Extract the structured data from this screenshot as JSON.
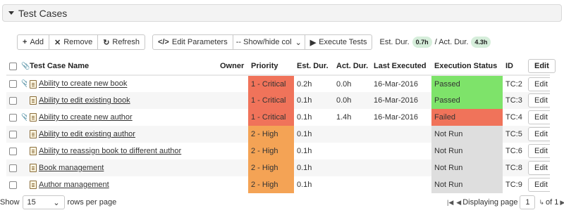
{
  "panel": {
    "title": "Test Cases"
  },
  "toolbar": {
    "add_label": "Add",
    "remove_label": "Remove",
    "refresh_label": "Refresh",
    "edit_params_label": "Edit Parameters",
    "show_hide_label": "-- Show/hide col",
    "execute_label": "Execute Tests",
    "est_dur_label": "Est. Dur.",
    "est_dur_value": "0.7h",
    "act_dur_label": "/ Act. Dur.",
    "act_dur_value": "4.3h"
  },
  "columns": {
    "name": "Test Case Name",
    "owner": "Owner",
    "priority": "Priority",
    "est_dur": "Est. Dur.",
    "act_dur": "Act. Dur.",
    "last_executed": "Last Executed",
    "status": "Execution Status",
    "id": "ID",
    "edit_header": "Edit"
  },
  "rows": [
    {
      "name": "Ability to create new book",
      "attachment": true,
      "owner": "",
      "priority": "1 - Critical",
      "priority_color": "#f0735a",
      "est_dur": "0.2h",
      "act_dur": "0.0h",
      "last_executed": "16-Mar-2016",
      "status": "Passed",
      "status_color": "#7ee36a",
      "id": "TC:2",
      "edit": "Edit"
    },
    {
      "name": "Ability to edit existing book",
      "attachment": false,
      "owner": "",
      "priority": "1 - Critical",
      "priority_color": "#f0735a",
      "est_dur": "0.1h",
      "act_dur": "0.0h",
      "last_executed": "16-Mar-2016",
      "status": "Passed",
      "status_color": "#7ee36a",
      "id": "TC:3",
      "edit": "Edit"
    },
    {
      "name": "Ability to create new author",
      "attachment": true,
      "owner": "",
      "priority": "1 - Critical",
      "priority_color": "#f0735a",
      "est_dur": "0.1h",
      "act_dur": "1.4h",
      "last_executed": "16-Mar-2016",
      "status": "Failed",
      "status_color": "#f0735a",
      "id": "TC:4",
      "edit": "Edit"
    },
    {
      "name": "Ability to edit existing author",
      "attachment": false,
      "owner": "",
      "priority": "2 - High",
      "priority_color": "#f4a355",
      "est_dur": "0.1h",
      "act_dur": "",
      "last_executed": "",
      "status": "Not Run",
      "status_color": "#dedede",
      "id": "TC:5",
      "edit": "Edit"
    },
    {
      "name": "Ability to reassign book to different author",
      "attachment": false,
      "owner": "",
      "priority": "2 - High",
      "priority_color": "#f4a355",
      "est_dur": "0.1h",
      "act_dur": "",
      "last_executed": "",
      "status": "Not Run",
      "status_color": "#dedede",
      "id": "TC:6",
      "edit": "Edit"
    },
    {
      "name": "Book management",
      "attachment": false,
      "owner": "",
      "priority": "2 - High",
      "priority_color": "#f4a355",
      "est_dur": "0.1h",
      "act_dur": "",
      "last_executed": "",
      "status": "Not Run",
      "status_color": "#dedede",
      "id": "TC:8",
      "edit": "Edit"
    },
    {
      "name": "Author management",
      "attachment": false,
      "owner": "",
      "priority": "2 - High",
      "priority_color": "#f4a355",
      "est_dur": "0.1h",
      "act_dur": "",
      "last_executed": "",
      "status": "Not Run",
      "status_color": "#dedede",
      "id": "TC:9",
      "edit": "Edit"
    }
  ],
  "footer": {
    "show_label": "Show",
    "page_size": "15",
    "rows_per_page_label": "rows per page",
    "displaying_label": "Displaying page",
    "current_page": "1",
    "of_label": "of 1"
  }
}
